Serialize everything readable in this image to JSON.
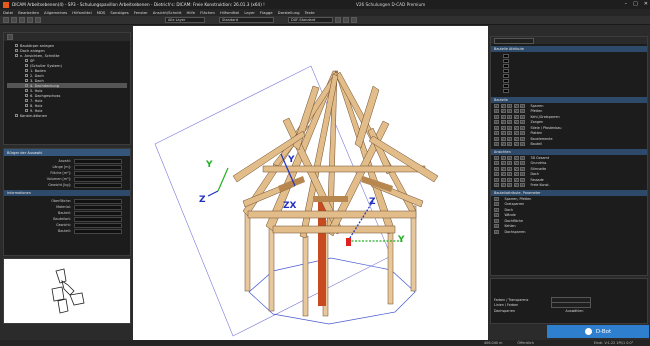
{
  "window": {
    "title": "DICAM Arbeitsebenen(4) - SP3 - Schulungspavillon Arbeitsebenen - Dietrich's: DICAM: Freie Konstruktion: 26.01.3 (x64) !",
    "center_text": "V26  Schulungen    D-CAD Premium"
  },
  "menu": [
    "Datei",
    "Bearbeiten",
    "Allgemeines",
    "Hilfsmittel",
    "MDS",
    "Sonstiges",
    "Fenster",
    "Ansicht/Schnitt",
    "Hilfe",
    "Flächen",
    "Hilfsmittel",
    "Layer",
    "Flagge",
    "Darstellung",
    "Texte"
  ],
  "toolbar": {
    "layer_select": "Alle Layer",
    "mode_select": "Standard",
    "drawing_select": "DXF-Standard"
  },
  "left_tree": {
    "items": [
      "Baukörper anlegen",
      "Dach anlegen",
      "n. Ansichten, Schnitte",
      "SP",
      "(Schuller System)",
      "1. Boden",
      "2. Dach",
      "3. Dach",
      "4. Dachdeckung",
      "5. Holz",
      "6. Dachgeschoss",
      "7. Holz",
      "8. Holz",
      "9. Holz",
      "Konstruktionen"
    ],
    "selected_index": 8
  },
  "props": {
    "header": "Bürger der Auswahl",
    "rows": [
      "Anzahl:",
      "Länge [m]:",
      "Fläche [m²]:",
      "Volumen [m³]:",
      "Gewicht [kg]:"
    ],
    "section2": "Informationen",
    "rows2": [
      "Oberfläche:",
      "Material:",
      "Bauteil:",
      "Bauteilart:",
      "Gewicht:",
      "Bauteil:"
    ]
  },
  "right_panel": {
    "top_header": "Bauteile Attribute",
    "layers_header": "Bauteile",
    "layers": [
      "Sparren",
      "Pfetten",
      "Kehl-/Gratsparren",
      "Zangen",
      "Stiele / Pfostenbau",
      "Platten",
      "Bauelemente",
      "Bauteil"
    ],
    "views_header": "Ansichten",
    "views": [
      "3D Gesamt",
      "Grundriss",
      "Stirnseite",
      "Dach",
      "Fassade",
      "Freie Konst."
    ],
    "props_header": "Bauteilattribute, Parameter",
    "props": [
      "Sparren, Pfetten",
      "Gratsparren",
      "Dach",
      "Wände",
      "Dachfläche",
      "Kehlen",
      "Dachsparren"
    ],
    "transparency_label": "Farben / Transparenz",
    "line_label": "Linien / Farben",
    "active_label": "Auswählen",
    "bottom_label": "Dachsparren",
    "dbot_label": "D-Bot"
  },
  "status": {
    "left": "406.040 m",
    "mid": "Layer: ...",
    "mid2": "Öffentlich",
    "right": "Eindr. V:1.22 1Pt/1 0:0°"
  },
  "scene": {
    "axis_colors": {
      "x": "#e02020",
      "y": "#20b020",
      "z": "#2030c0"
    },
    "wood_light": "#e8c89a",
    "wood_dark": "#b8864f",
    "accent_post": "#c84a20"
  }
}
